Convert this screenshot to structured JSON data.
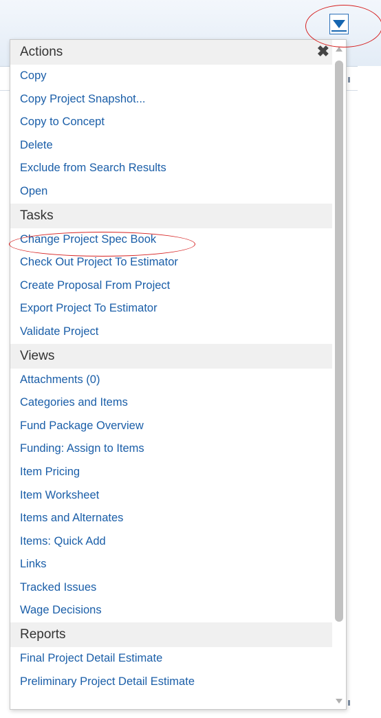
{
  "dropdown": {
    "toggle_icon": "caret-down-icon",
    "close_icon": "close-icon",
    "close_glyph": "✖"
  },
  "sections": [
    {
      "title": "Actions",
      "items": [
        "Copy",
        "Copy Project Snapshot...",
        "Copy to Concept",
        "Delete",
        "Exclude from Search Results",
        "Open"
      ]
    },
    {
      "title": "Tasks",
      "items": [
        "Change Project Spec Book",
        "Check Out Project To Estimator",
        "Create Proposal From Project",
        "Export Project To Estimator",
        "Validate Project"
      ]
    },
    {
      "title": "Views",
      "items": [
        "Attachments (0)",
        "Categories and Items",
        "Fund Package Overview",
        "Funding: Assign to Items",
        "Item Pricing",
        "Item Worksheet",
        "Items and Alternates",
        "Items: Quick Add",
        "Links",
        "Tracked Issues",
        "Wage Decisions"
      ]
    },
    {
      "title": "Reports",
      "items": [
        "Final Project Detail Estimate",
        "Preliminary Project Detail Estimate"
      ]
    }
  ],
  "colors": {
    "link": "#1a5ea8",
    "header_bg": "#f0f0f0",
    "annotation": "#d62020",
    "accent": "#1565b0"
  }
}
